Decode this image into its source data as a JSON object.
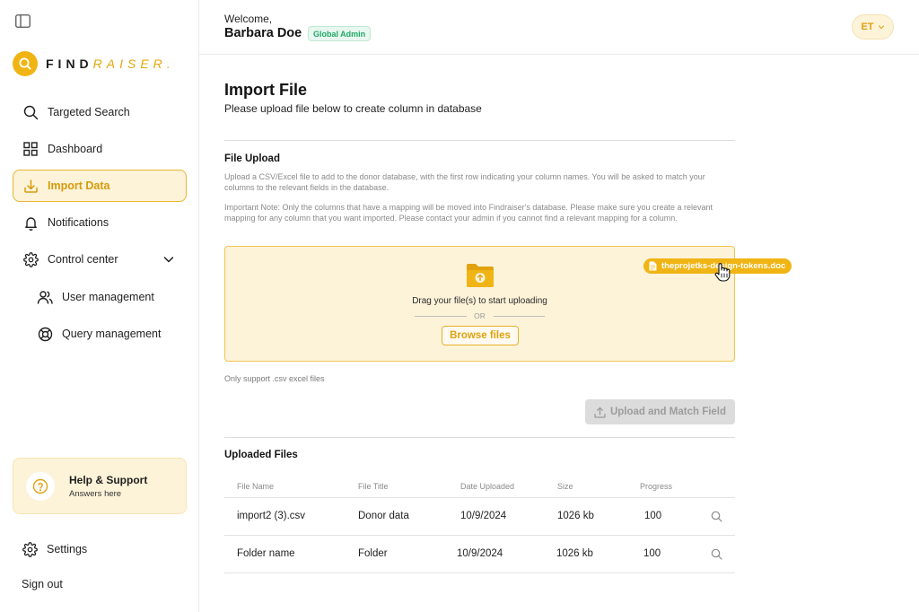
{
  "brand": {
    "find": "FIND",
    "raiser": "RAISER",
    "dot": "."
  },
  "sidebar": {
    "items": [
      {
        "label": "Targeted Search",
        "icon": "search-icon"
      },
      {
        "label": "Dashboard",
        "icon": "dashboard-grid-icon"
      },
      {
        "label": "Import Data",
        "icon": "download-icon",
        "active": true
      },
      {
        "label": "Notifications",
        "icon": "bell-icon"
      },
      {
        "label": "Control center",
        "icon": "gear-icon",
        "expanded": true
      }
    ],
    "sub_items": [
      {
        "label": "User management",
        "icon": "users-icon"
      },
      {
        "label": "Query management",
        "icon": "lifebuoy-icon"
      }
    ],
    "help": {
      "title": "Help & Support",
      "subtitle": "Answers here"
    },
    "settings_label": "Settings",
    "signout_label": "Sign out"
  },
  "header": {
    "welcome": "Welcome,",
    "user_name": "Barbara Doe",
    "role": "Global Admin",
    "avatar_initials": "ET"
  },
  "main": {
    "title": "Import File",
    "subtitle": "Please upload file below to create column in database",
    "file_upload": {
      "title": "File Upload",
      "description": "Upload a CSV/Excel file to add to the donor database, with the first row indicating your column names. You will be asked to match your columns to the relevant fields in the database.",
      "note": "Important Note: Only the columns that have a mapping will be moved into Findraiser's database. Please make sure you create a relevant mapping for any column that you want imported. Please contact your admin if you cannot find a relevant mapping for a column.",
      "drag_text": "Drag your file(s) to start uploading",
      "or_text": "OR",
      "browse_label": "Browse files",
      "dragged_file": "theprojetks-design-tokens.doc",
      "support_note": "Only support .csv excel files",
      "upload_button": "Upload and Match Field"
    },
    "uploaded": {
      "title": "Uploaded Files",
      "columns": [
        "File Name",
        "File Title",
        "Date Uploaded",
        "Size",
        "Progress"
      ],
      "rows": [
        {
          "name": "import2 (3).csv",
          "title": "Donor data",
          "date": "10/9/2024",
          "size": "1026 kb",
          "progress": "100"
        },
        {
          "name": "Folder name",
          "title": "Folder",
          "date": "10/9/2024",
          "size": "1026 kb",
          "progress": "100"
        }
      ]
    }
  },
  "colors": {
    "accent": "#f0b514",
    "accent_text": "#d79b0a",
    "accent_bg": "#fdf3d9",
    "badge_green": "#22a86a"
  }
}
